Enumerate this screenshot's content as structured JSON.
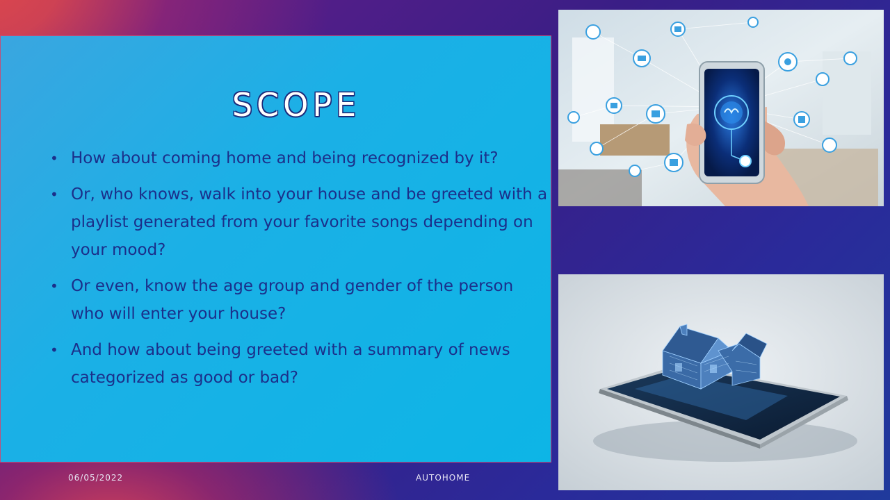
{
  "slide": {
    "title": "SCOPE",
    "bullets": [
      "How about coming home and being recognized by it?",
      "Or, who knows, walk into your house and be greeted with a playlist generated from your favorite songs depending on your mood?",
      "Or even, know the age group and gender of the person who will enter your house?",
      "And how about being greeted with a summary of news categorized as good or bad?"
    ],
    "bullet_char": "•"
  },
  "footer": {
    "date": "06/05/2022",
    "name": "AUTOHOME"
  },
  "images": {
    "top": "smartphone-smart-home-network",
    "bottom": "house-model-on-tablet"
  }
}
